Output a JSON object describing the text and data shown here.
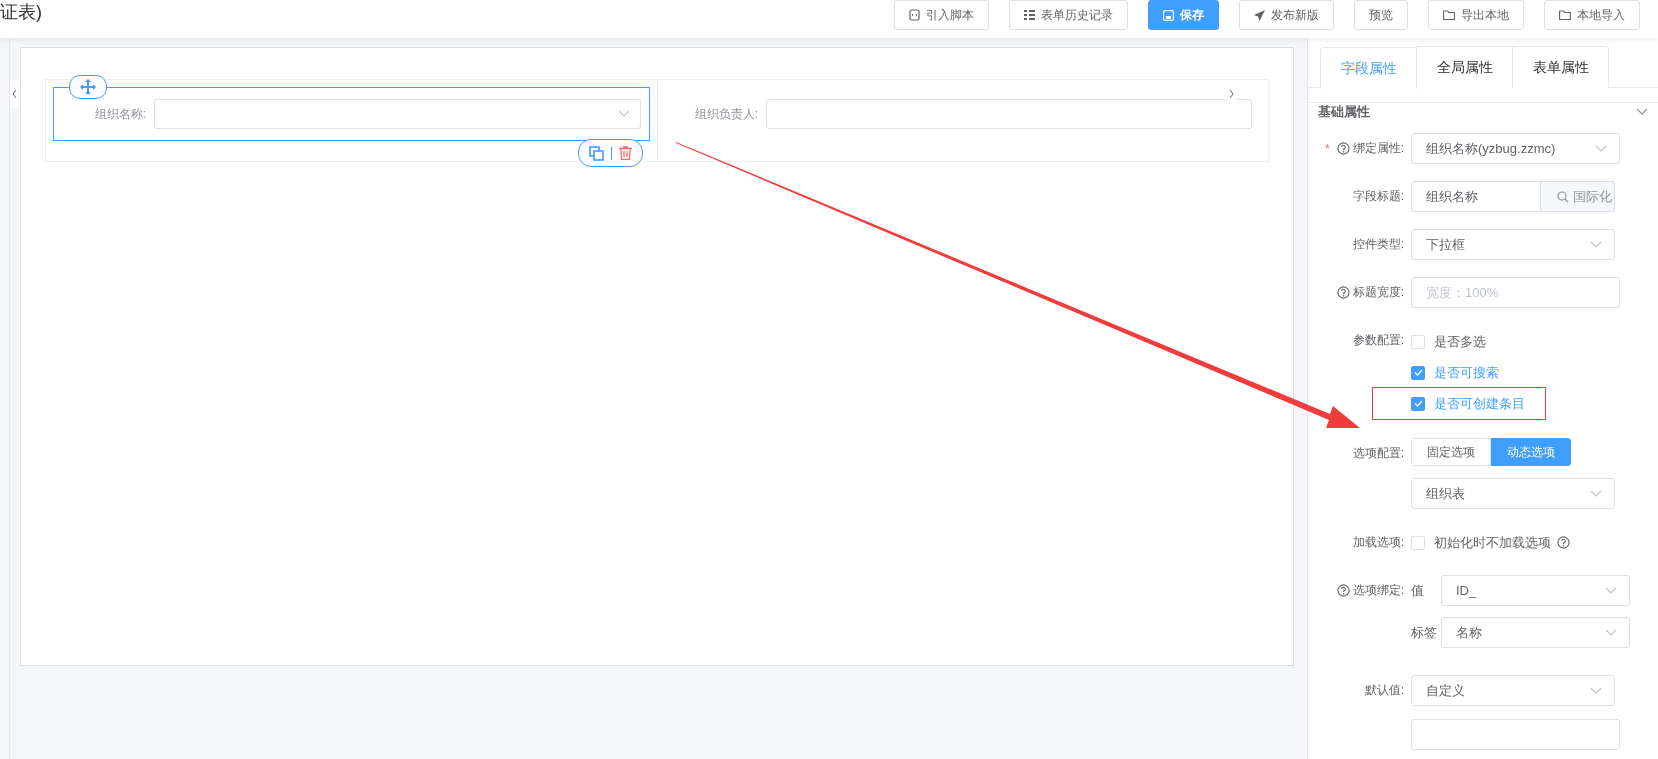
{
  "header": {
    "title": "证表)",
    "buttons": [
      {
        "label": "引入脚本",
        "kind": "default"
      },
      {
        "label": "表单历史记录",
        "kind": "default"
      },
      {
        "label": "保存",
        "kind": "primary"
      },
      {
        "label": "发布新版",
        "kind": "default"
      },
      {
        "label": "预览",
        "kind": "default"
      },
      {
        "label": "导出本地",
        "kind": "default"
      },
      {
        "label": "本地导入",
        "kind": "default"
      }
    ]
  },
  "canvas": {
    "fields": [
      {
        "label": "组织名称:",
        "kind": "select",
        "selected": true
      },
      {
        "label": "组织负责人:",
        "kind": "input",
        "selected": false
      }
    ]
  },
  "panel": {
    "tabs": [
      {
        "label": "字段属性",
        "selected": true
      },
      {
        "label": "全局属性",
        "selected": false
      },
      {
        "label": "表单属性",
        "selected": false
      }
    ],
    "section": {
      "title": "基础属性",
      "expanded": true
    },
    "rows": [
      {
        "kind": "select",
        "label": "绑定属性:",
        "required_mark": "*",
        "help": true,
        "value": "组织名称(yzbug.zzmc)"
      },
      {
        "kind": "input-addon",
        "label": "字段标题:",
        "value": "组织名称",
        "addon": "国际化"
      },
      {
        "kind": "select",
        "label": "控件类型:",
        "value": "下拉框"
      },
      {
        "kind": "input",
        "label": "标题宽度:",
        "help": true,
        "placeholder": "宽度：100%"
      },
      {
        "kind": "checkboxes",
        "label": "参数配置:",
        "options": [
          {
            "label": "是否多选",
            "checked": false,
            "highlighted": false
          },
          {
            "label": "是否可搜索",
            "checked": true,
            "highlighted": false
          },
          {
            "label": "是否可创建条目",
            "checked": true,
            "highlighted": true
          }
        ]
      },
      {
        "kind": "segmented",
        "label": "选项配置:",
        "options": [
          {
            "label": "固定选项",
            "selected": false
          },
          {
            "label": "动态选项",
            "selected": true
          }
        ]
      },
      {
        "kind": "select",
        "value": "组织表"
      },
      {
        "kind": "checkbox",
        "label": "加载选项:",
        "text": "初始化时不加载选项",
        "checked": false
      },
      {
        "kind": "pairs",
        "label": "选项绑定:",
        "help": true,
        "pairs": [
          {
            "label": "值",
            "value": "ID_"
          },
          {
            "label": "标签",
            "value": "名称"
          }
        ]
      },
      {
        "kind": "select",
        "label": "默认值:",
        "value": "自定义"
      },
      {
        "kind": "input"
      }
    ]
  }
}
